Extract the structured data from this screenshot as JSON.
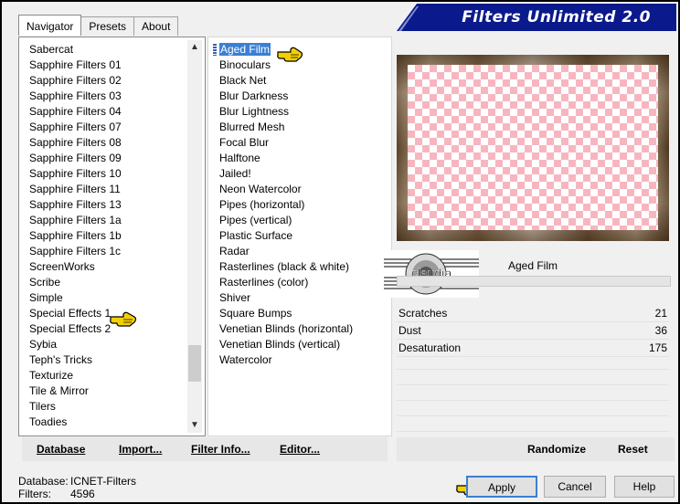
{
  "window": {
    "title": "Filters Unlimited 2.0"
  },
  "tabs": [
    {
      "label": "Navigator"
    },
    {
      "label": "Presets"
    },
    {
      "label": "About"
    }
  ],
  "categories": [
    "Sabercat",
    "Sapphire Filters 01",
    "Sapphire Filters 02",
    "Sapphire Filters 03",
    "Sapphire Filters 04",
    "Sapphire Filters 07",
    "Sapphire Filters 08",
    "Sapphire Filters 09",
    "Sapphire Filters 10",
    "Sapphire Filters 11",
    "Sapphire Filters 13",
    "Sapphire Filters 1a",
    "Sapphire Filters 1b",
    "Sapphire Filters 1c",
    "ScreenWorks",
    "Scribe",
    "Simple",
    "Special Effects 1",
    "Special Effects 2",
    "Sybia",
    "Teph's Tricks",
    "Texturize",
    "Tile & Mirror",
    "Tilers",
    "Toadies"
  ],
  "filters": [
    "Aged Film",
    "Binoculars",
    "Black Net",
    "Blur Darkness",
    "Blur Lightness",
    "Blurred Mesh",
    "Focal Blur",
    "Halftone",
    "Jailed!",
    "Neon Watercolor",
    "Pipes (horizontal)",
    "Pipes (vertical)",
    "Plastic Surface",
    "Radar",
    "Rasterlines (black & white)",
    "Rasterlines (color)",
    "Shiver",
    "Square Bumps",
    "Venetian Blinds (horizontal)",
    "Venetian Blinds (vertical)",
    "Watercolor"
  ],
  "selected_filter": "Aged Film",
  "watermark": "claudia",
  "parameters": [
    {
      "label": "Scratches",
      "value": "21"
    },
    {
      "label": "Dust",
      "value": "36"
    },
    {
      "label": "Desaturation",
      "value": "175"
    }
  ],
  "toolbar": {
    "database": "Database",
    "import": "Import...",
    "filter_info": "Filter Info...",
    "editor": "Editor..."
  },
  "actions": {
    "randomize": "Randomize",
    "reset": "Reset"
  },
  "status": {
    "database_label": "Database:",
    "database_value": "ICNET-Filters",
    "filters_label": "Filters:",
    "filters_value": "4596"
  },
  "buttons": {
    "apply": "Apply",
    "cancel": "Cancel",
    "help": "Help"
  },
  "icons": {
    "pointer": "pointing-hand-icon",
    "scroll_up": "arrow-up-icon",
    "scroll_down": "arrow-down-icon"
  },
  "colors": {
    "title_bar": "#0a1a8c",
    "selection": "#3a7fd4",
    "pointer": "#f5d000",
    "checker_pink": "#f7b6bf"
  }
}
